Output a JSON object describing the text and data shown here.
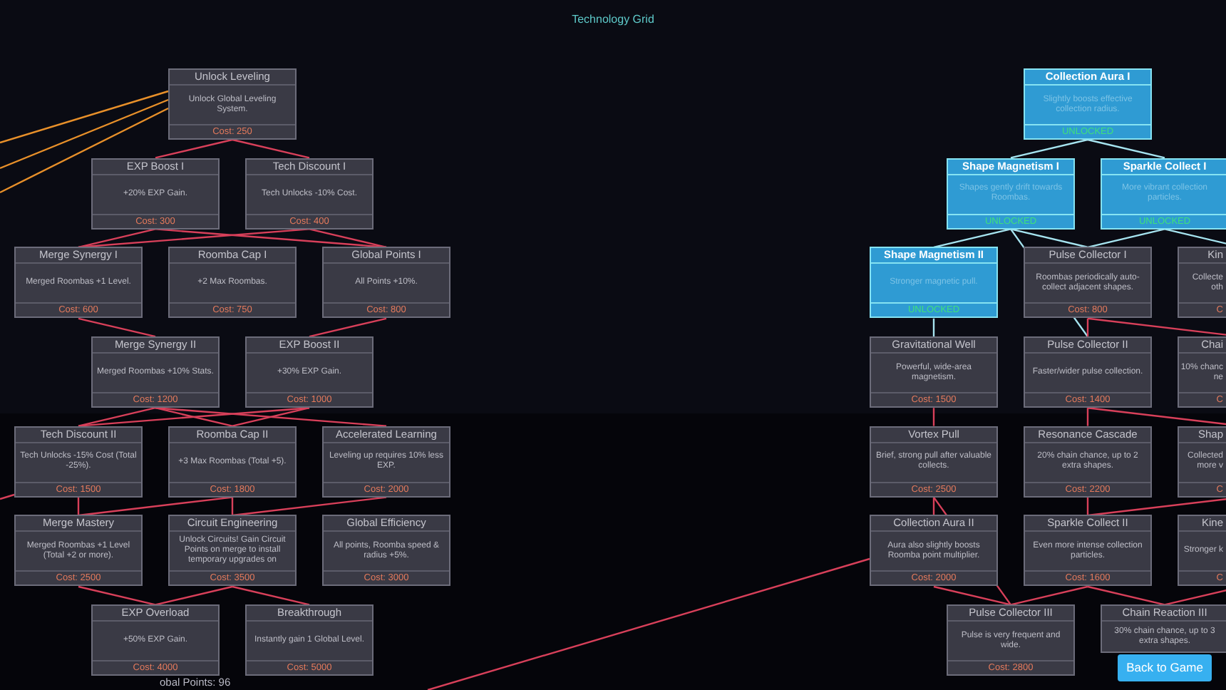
{
  "title": "Technology Grid",
  "trees": [
    {
      "rows": [
        [
          {
            "kind": "full",
            "title": "Unlock Leveling",
            "description": "Unlock Global Leveling System.",
            "footer": "Cost: 250",
            "unlocked": false
          }
        ],
        [
          {
            "kind": "full",
            "title": "EXP Boost I",
            "description": "+20% EXP Gain.",
            "footer": "Cost: 300",
            "unlocked": false
          },
          {
            "kind": "full",
            "title": "Tech Discount I",
            "description": "Tech Unlocks -10% Cost.",
            "footer": "Cost: 400",
            "unlocked": false
          }
        ],
        [
          {
            "kind": "full",
            "title": "Merge Synergy I",
            "description": "Merged Roombas +1 Level.",
            "footer": "Cost: 600",
            "unlocked": false
          },
          {
            "kind": "full",
            "title": "Roomba Cap I",
            "description": "+2 Max Roombas.",
            "footer": "Cost: 750",
            "unlocked": false
          },
          {
            "kind": "full",
            "title": "Global Points I",
            "description": "All Points +10%.",
            "footer": "Cost: 800",
            "unlocked": false
          }
        ],
        [
          {
            "kind": "full",
            "title": "Merge Synergy II",
            "description": "Merged Roombas +10% Stats.",
            "footer": "Cost: 1200",
            "unlocked": false
          },
          {
            "kind": "full",
            "title": "EXP Boost II",
            "description": "+30% EXP Gain.",
            "footer": "Cost: 1000",
            "unlocked": false
          }
        ],
        [
          {
            "kind": "full",
            "title": "Tech Discount II",
            "description": "Tech Unlocks -15% Cost (Total -25%).",
            "footer": "Cost: 1500",
            "unlocked": false
          },
          {
            "kind": "full",
            "title": "Roomba Cap II",
            "description": "+3 Max Roombas (Total +5).",
            "footer": "Cost: 1800",
            "unlocked": false
          },
          {
            "kind": "full",
            "title": "Accelerated Learning",
            "description": "Leveling up requires 10% less EXP.",
            "footer": "Cost: 2000",
            "unlocked": false
          }
        ],
        [
          {
            "kind": "full",
            "title": "Merge Mastery",
            "description": "Merged Roombas +1 Level (Total +2 or more).",
            "footer": "Cost: 2500",
            "unlocked": false
          },
          {
            "kind": "full",
            "title": "Circuit Engineering",
            "description": "Unlock Circuits! Gain Circuit Points on merge to install temporary upgrades on",
            "footer": "Cost: 3500",
            "unlocked": false
          },
          {
            "kind": "full",
            "title": "Global Efficiency",
            "description": "All points, Roomba speed & radius +5%.",
            "footer": "Cost: 3000",
            "unlocked": false
          }
        ],
        [
          {
            "kind": "full",
            "title": "EXP Overload",
            "description": "+50% EXP Gain.",
            "footer": "Cost: 4000",
            "unlocked": false
          },
          {
            "kind": "full",
            "title": "Breakthrough",
            "description": "Instantly gain 1 Global Level.",
            "footer": "Cost: 5000",
            "unlocked": false
          }
        ]
      ]
    },
    {
      "rows": [
        [
          {
            "kind": "full",
            "title": "Collection Aura I",
            "description": "Slightly boosts effective collection radius.",
            "footer": "UNLOCKED",
            "unlocked": true
          }
        ],
        [
          {
            "kind": "full",
            "title": "Shape Magnetism I",
            "description": "Shapes gently drift towards Roombas.",
            "footer": "UNLOCKED",
            "unlocked": true
          },
          {
            "kind": "full",
            "title": "Sparkle Collect I",
            "description": "More vibrant collection particles.",
            "footer": "UNLOCKED",
            "unlocked": true
          }
        ],
        [
          {
            "kind": "full",
            "title": "Shape Magnetism II",
            "description": "Stronger magnetic pull.",
            "footer": "UNLOCKED",
            "unlocked": true
          },
          {
            "kind": "full",
            "title": "Pulse Collector I",
            "description": "Roombas periodically auto-collect adjacent shapes.",
            "footer": "Cost: 800",
            "unlocked": false
          },
          {
            "kind": "clipped",
            "title": "Kin",
            "description_lines": [
              "Collecte",
              "oth"
            ],
            "footer": "C",
            "unlocked": false
          }
        ],
        [
          {
            "kind": "full",
            "title": "Gravitational Well",
            "description": "Powerful, wide-area magnetism.",
            "footer": "Cost: 1500",
            "unlocked": false
          },
          {
            "kind": "full",
            "title": "Pulse Collector II",
            "description": "Faster/wider pulse collection.",
            "footer": "Cost: 1400",
            "unlocked": false
          },
          {
            "kind": "clipped",
            "title": "Chai",
            "description_lines": [
              "10% chanc",
              "ne"
            ],
            "footer": "C",
            "unlocked": false
          }
        ],
        [
          {
            "kind": "full",
            "title": "Vortex Pull",
            "description": "Brief, strong pull after valuable collects.",
            "footer": "Cost: 2500",
            "unlocked": false
          },
          {
            "kind": "full",
            "title": "Resonance Cascade",
            "description": "20% chain chance, up to 2 extra shapes.",
            "footer": "Cost: 2200",
            "unlocked": false
          },
          {
            "kind": "clipped",
            "title": "Shap",
            "description_lines": [
              "Collected",
              "more v"
            ],
            "footer": "C",
            "unlocked": false
          }
        ],
        [
          {
            "kind": "full",
            "title": "Collection Aura II",
            "description": "Aura also slightly boosts Roomba point multiplier.",
            "footer": "Cost: 2000",
            "unlocked": false
          },
          {
            "kind": "full",
            "title": "Sparkle Collect II",
            "description": "Even more intense collection particles.",
            "footer": "Cost: 1600",
            "unlocked": false
          },
          {
            "kind": "clipped",
            "title": "Kine",
            "description_lines": [
              "Stronger k"
            ],
            "footer": "C",
            "unlocked": false
          }
        ],
        [
          {
            "kind": "full",
            "title": "Pulse Collector III",
            "description": "Pulse is very frequent and wide.",
            "footer": "Cost: 2800",
            "unlocked": false
          },
          {
            "kind": "full",
            "title": "Chain Reaction III",
            "description": "30% chain chance, up to 3 extra shapes.",
            "unlocked": false
          }
        ]
      ]
    }
  ],
  "points_label": "obal Points: 96",
  "back_button": "Back to Game"
}
